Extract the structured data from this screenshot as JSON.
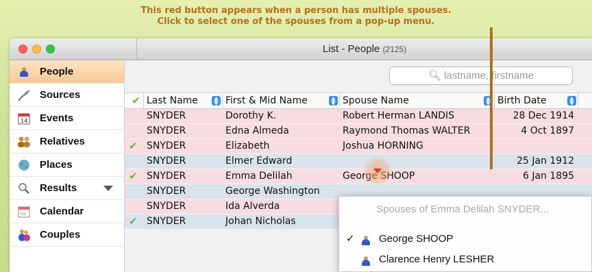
{
  "caption": {
    "line1": "This red button appears when a person has multiple spouses.",
    "line2": "Click to select one of the spouses from a pop-up menu."
  },
  "window": {
    "title": "List - People",
    "count": "(2125)"
  },
  "sidebar": {
    "items": [
      {
        "label": "People",
        "icon": "person-icon",
        "active": true
      },
      {
        "label": "Sources",
        "icon": "quill-icon"
      },
      {
        "label": "Events",
        "icon": "calendar-14-icon"
      },
      {
        "label": "Relatives",
        "icon": "relatives-icon"
      },
      {
        "label": "Places",
        "icon": "globe-icon"
      },
      {
        "label": "Results",
        "icon": "magnifier-icon"
      },
      {
        "label": "Calendar",
        "icon": "calendar-icon"
      },
      {
        "label": "Couples",
        "icon": "couple-icon"
      }
    ]
  },
  "search": {
    "placeholder": "lastname, firstname"
  },
  "table": {
    "columns": [
      "Last Name",
      "First & Mid Name",
      "Spouse Name",
      "Birth Date"
    ],
    "rows": [
      {
        "checked": false,
        "last": "SNYDER",
        "first": "Dorothy K.",
        "spouse": "Robert Herman LANDIS",
        "birth": "28 Dec 1914"
      },
      {
        "checked": false,
        "last": "SNYDER",
        "first": "Edna Almeda",
        "spouse": "Raymond Thomas WALTER",
        "birth": "4 Oct 1897"
      },
      {
        "checked": true,
        "last": "SNYDER",
        "first": "Elizabeth",
        "spouse": "Joshua HORNING",
        "birth": ""
      },
      {
        "checked": false,
        "last": "SNYDER",
        "first": "Elmer Edward",
        "spouse": "",
        "birth": "25 Jan 1912"
      },
      {
        "checked": true,
        "last": "SNYDER",
        "first": "Emma Delilah",
        "spouse": "George SHOOP",
        "birth": "6 Jan 1895"
      },
      {
        "checked": false,
        "last": "SNYDER",
        "first": "George Washington",
        "spouse": "",
        "birth": ""
      },
      {
        "checked": false,
        "last": "SNYDER",
        "first": "Ida Alverda",
        "spouse": "",
        "birth": ""
      },
      {
        "checked": true,
        "last": "SNYDER",
        "first": "Johan Nicholas",
        "spouse": "",
        "birth": ""
      }
    ]
  },
  "popup": {
    "header": "Spouses of Emma Delilah SNYDER...",
    "items": [
      {
        "label": "George SHOOP",
        "selected": true,
        "check": "✓"
      },
      {
        "label": "Clarence Henry LESHER",
        "selected": false,
        "check": ""
      }
    ]
  },
  "colors": {
    "accent_orange": "#b06f1c",
    "row_pink": "#f7dde0",
    "row_blue": "#dae3ec",
    "flag_red": "#e2342a",
    "check_green": "#6fb13f"
  }
}
